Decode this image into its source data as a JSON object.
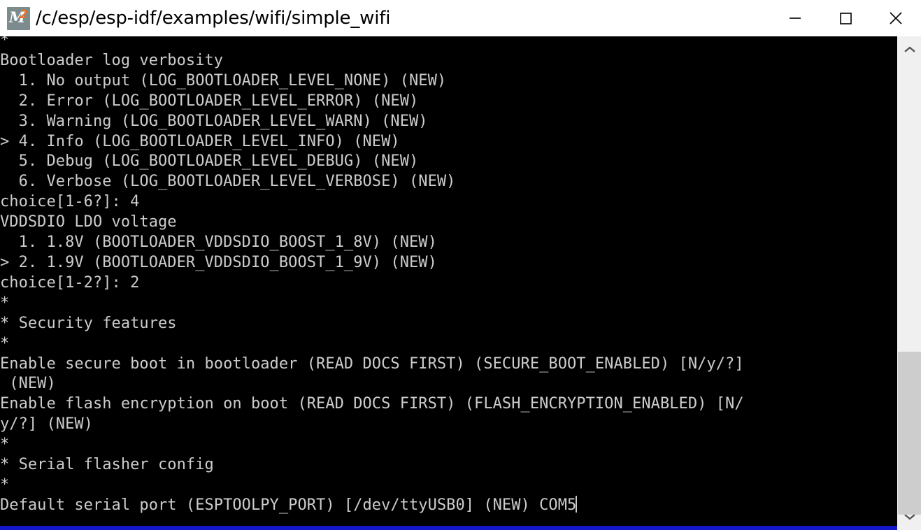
{
  "window": {
    "title": "/c/esp/esp-idf/examples/wifi/simple_wifi",
    "app_icon_name": "msys2-icon",
    "icon_letter": "M",
    "icon_digit": "2",
    "icon_bg_color": "#7b8b8e",
    "icon_accent_color": "#f07020",
    "controls": {
      "minimize_label": "Minimize",
      "maximize_label": "Maximize",
      "close_label": "Close"
    }
  },
  "terminal": {
    "background_color": "#000000",
    "foreground_color": "#cccccc",
    "accent_line_color": "#1414c8",
    "cursor_visible": true,
    "lines": [
      "*",
      "Bootloader log verbosity",
      "  1. No output (LOG_BOOTLOADER_LEVEL_NONE) (NEW)",
      "  2. Error (LOG_BOOTLOADER_LEVEL_ERROR) (NEW)",
      "  3. Warning (LOG_BOOTLOADER_LEVEL_WARN) (NEW)",
      "> 4. Info (LOG_BOOTLOADER_LEVEL_INFO) (NEW)",
      "  5. Debug (LOG_BOOTLOADER_LEVEL_DEBUG) (NEW)",
      "  6. Verbose (LOG_BOOTLOADER_LEVEL_VERBOSE) (NEW)",
      "choice[1-6?]: 4",
      "VDDSDIO LDO voltage",
      "  1. 1.8V (BOOTLOADER_VDDSDIO_BOOST_1_8V) (NEW)",
      "> 2. 1.9V (BOOTLOADER_VDDSDIO_BOOST_1_9V) (NEW)",
      "choice[1-2?]: 2",
      "*",
      "* Security features",
      "*",
      "Enable secure boot in bootloader (READ DOCS FIRST) (SECURE_BOOT_ENABLED) [N/y/?]",
      " (NEW)",
      "Enable flash encryption on boot (READ DOCS FIRST) (FLASH_ENCRYPTION_ENABLED) [N/",
      "y/?] (NEW)",
      "*",
      "* Serial flasher config",
      "*",
      "Default serial port (ESPTOOLPY_PORT) [/dev/ttyUSB0] (NEW) COM5"
    ],
    "prompt_answers": {
      "bootloader_log_verbosity": "4",
      "vddsdio_ldo_voltage": "2",
      "default_serial_port": "COM5"
    }
  },
  "scrollbar": {
    "up_arrow_name": "scroll-up",
    "down_arrow_name": "scroll-down",
    "thumb_name": "scroll-thumb",
    "track_color": "#f0f0f0",
    "thumb_color": "#cdcdcd"
  }
}
